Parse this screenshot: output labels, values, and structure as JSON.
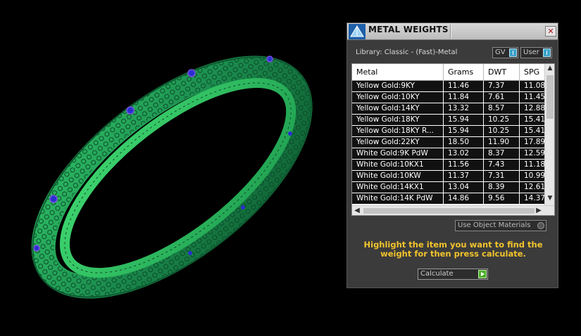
{
  "panel": {
    "title": "METAL WEIGHTS",
    "close_label": "✕",
    "library": "Library: Classic - (Fast)-Metal",
    "toggle_gv": "GV",
    "toggle_user": "User",
    "columns": [
      "Metal",
      "Grams",
      "DWT",
      "SPG"
    ],
    "rows": [
      [
        "Yellow Gold:9KY",
        "11.46",
        "7.37",
        "11.08"
      ],
      [
        "Yellow Gold:10KY",
        "11.84",
        "7.61",
        "11.45"
      ],
      [
        "Yellow Gold:14KY",
        "13.32",
        "8.57",
        "12.88"
      ],
      [
        "Yellow Gold:18KY",
        "15.94",
        "10.25",
        "15.41"
      ],
      [
        "Yellow Gold:18KY R...",
        "15.94",
        "10.25",
        "15.41"
      ],
      [
        "Yellow Gold:22KY",
        "18.50",
        "11.90",
        "17.89"
      ],
      [
        "White Gold:9K PdW",
        "13.02",
        "8.37",
        "12.59"
      ],
      [
        "White Gold:10KX1",
        "11.56",
        "7.43",
        "11.18"
      ],
      [
        "White Gold:10KW",
        "11.37",
        "7.31",
        "10.99"
      ],
      [
        "White Gold:14KX1",
        "13.04",
        "8.39",
        "12.61"
      ],
      [
        "White Gold:14K PdW",
        "14.86",
        "9.56",
        "14.37"
      ]
    ],
    "use_object_materials": "Use Object Materials",
    "hint": "Highlight the item you want to find the weight for then press calculate.",
    "calculate_label": "Calculate"
  },
  "colors": {
    "bangle": "#1e8a52",
    "bangle_inner": "#3ccf6e",
    "gem": "#2a2fd0",
    "hint": "#f2c32c"
  }
}
